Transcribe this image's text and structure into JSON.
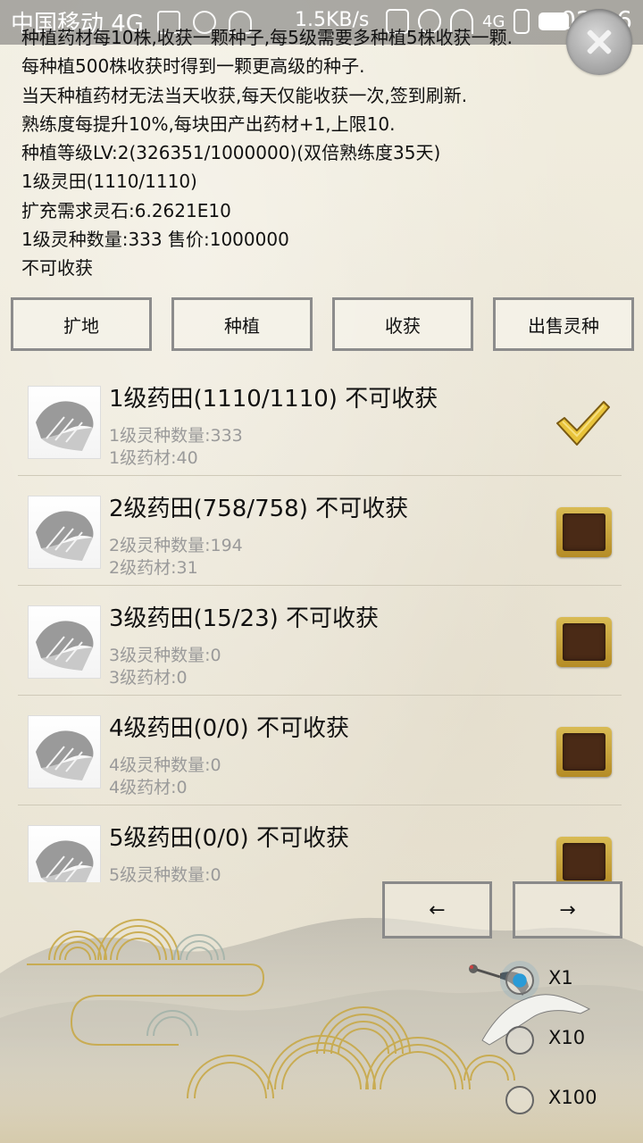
{
  "status_bar": {
    "carrier": "中国移动 4G",
    "speed": "1.5KB/s",
    "network": "4G",
    "time": "02:16"
  },
  "info": {
    "lines": [
      "种植药材每10株,收获一颗种子,每5级需要多种植5株收获一颗.",
      "每种植500株收获时得到一颗更高级的种子.",
      "当天种植药材无法当天收获,每天仅能收获一次,签到刷新.",
      "熟练度每提升10%,每块田产出药材+1,上限10.",
      "种植等级LV:2(326351/1000000)(双倍熟练度35天)",
      "1级灵田(1110/1110)",
      "扩充需求灵石:6.2621E10",
      "1级灵种数量:333    售价:1000000",
      "不可收获"
    ]
  },
  "actions": {
    "expand": "扩地",
    "plant": "种植",
    "harvest": "收获",
    "sell_seed": "出售灵种"
  },
  "fields": [
    {
      "title": "1级药田(1110/1110)  不可收获",
      "seeds": "1级灵种数量:333",
      "herbs": "1级药材:40",
      "selected": true
    },
    {
      "title": "2级药田(758/758)  不可收获",
      "seeds": "2级灵种数量:194",
      "herbs": "2级药材:31",
      "selected": false
    },
    {
      "title": "3级药田(15/23)  不可收获",
      "seeds": "3级灵种数量:0",
      "herbs": "3级药材:0",
      "selected": false
    },
    {
      "title": "4级药田(0/0)  不可收获",
      "seeds": "4级灵种数量:0",
      "herbs": "4级药材:0",
      "selected": false
    },
    {
      "title": "5级药田(0/0)  不可收获",
      "seeds": "5级灵种数量:0",
      "herbs": "",
      "selected": false
    }
  ],
  "pager": {
    "prev": "←",
    "next": "→"
  },
  "multipliers": {
    "options": [
      "X1",
      "X10",
      "X100"
    ],
    "selected": "X1"
  },
  "colors": {
    "accent_gold": "#c9a437",
    "checkbox_inner": "#4a2a16",
    "radio_selected": "#2a9bd7"
  }
}
